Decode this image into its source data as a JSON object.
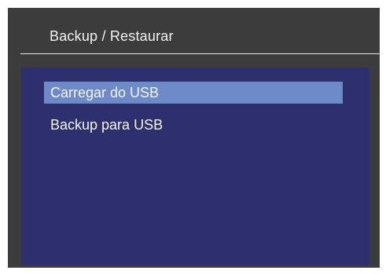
{
  "header": {
    "title": "Backup / Restaurar"
  },
  "menu": {
    "items": [
      {
        "label": "Carregar do USB",
        "selected": true
      },
      {
        "label": "Backup para USB",
        "selected": false
      }
    ]
  },
  "colors": {
    "frame_background": "#3c3c3c",
    "panel_background": "#2e2f6e",
    "selection_highlight": "#6f8ac8",
    "text": "#f4f4f4"
  }
}
